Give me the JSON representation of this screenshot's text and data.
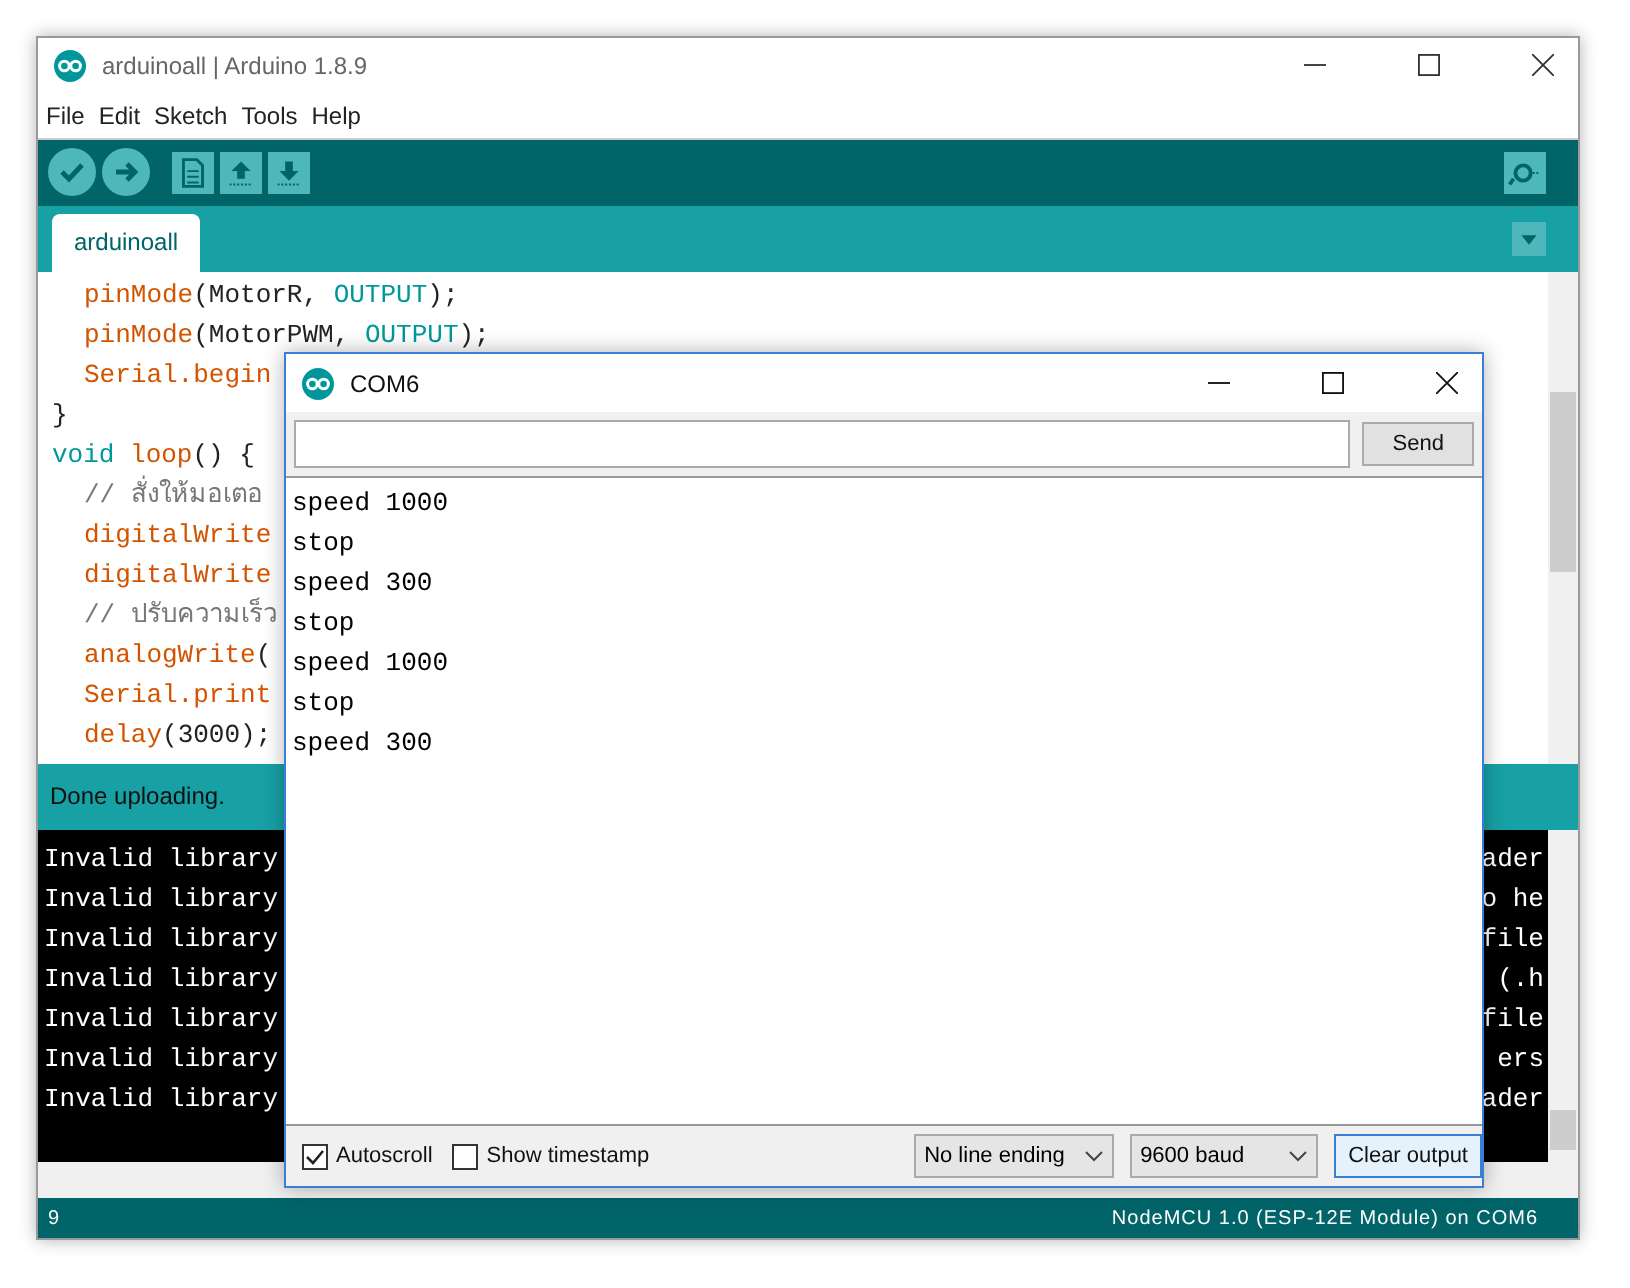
{
  "window": {
    "title": "arduinoall | Arduino 1.8.9"
  },
  "menu": [
    "File",
    "Edit",
    "Sketch",
    "Tools",
    "Help"
  ],
  "tabs": [
    {
      "label": "arduinoall",
      "selected": true
    }
  ],
  "editor": {
    "lines": [
      {
        "kind": "indented",
        "segments": [
          {
            "kind": "func",
            "text": "pinMode"
          },
          {
            "kind": "plain",
            "text": "(MotorR, "
          },
          {
            "kind": "const",
            "text": "OUTPUT"
          },
          {
            "kind": "plain",
            "text": ");"
          }
        ]
      },
      {
        "kind": "indented",
        "segments": [
          {
            "kind": "func",
            "text": "pinMode"
          },
          {
            "kind": "plain",
            "text": "(MotorPWM, "
          },
          {
            "kind": "const",
            "text": "OUTPUT"
          },
          {
            "kind": "plain",
            "text": ");"
          }
        ]
      },
      {
        "kind": "indented",
        "segments": [
          {
            "kind": "func",
            "text": "Serial.begin"
          }
        ]
      },
      {
        "kind": "top",
        "segments": [
          {
            "kind": "plain",
            "text": "}"
          }
        ]
      },
      {
        "kind": "top",
        "segments": [
          {
            "kind": "keyword",
            "text": "void"
          },
          {
            "kind": "func",
            "text": " loop"
          },
          {
            "kind": "plain",
            "text": "() {"
          }
        ]
      },
      {
        "kind": "indented",
        "segments": [
          {
            "kind": "comment",
            "text": "// สั่งให้มอเตอ"
          }
        ]
      },
      {
        "kind": "indented",
        "segments": [
          {
            "kind": "func",
            "text": "digitalWrite"
          }
        ]
      },
      {
        "kind": "indented",
        "segments": [
          {
            "kind": "func",
            "text": "digitalWrite"
          }
        ]
      },
      {
        "kind": "indented",
        "segments": [
          {
            "kind": "comment",
            "text": "// ปรับความเร็ว"
          }
        ]
      },
      {
        "kind": "indented",
        "segments": [
          {
            "kind": "func",
            "text": "analogWrite"
          },
          {
            "kind": "plain",
            "text": "("
          }
        ]
      },
      {
        "kind": "indented",
        "segments": [
          {
            "kind": "func",
            "text": "Serial.print"
          }
        ]
      },
      {
        "kind": "indented",
        "segments": [
          {
            "kind": "func",
            "text": "delay"
          },
          {
            "kind": "plain",
            "text": "(3000);"
          }
        ]
      }
    ]
  },
  "message": "Done uploading.",
  "console": [
    {
      "left": "Invalid library",
      "right": "ader"
    },
    {
      "left": "Invalid library",
      "right": "o he"
    },
    {
      "left": "Invalid library",
      "right": "file"
    },
    {
      "left": "Invalid library",
      "right": " (.h"
    },
    {
      "left": "Invalid library",
      "right": "file"
    },
    {
      "left": "Invalid library",
      "right": "ers"
    },
    {
      "left": "Invalid library",
      "right": "ader"
    }
  ],
  "status_bar": {
    "line": "9",
    "board": "NodeMCU 1.0 (ESP-12E Module) on COM6"
  },
  "serial_monitor": {
    "title": "COM6",
    "send": "Send",
    "output": [
      "speed 1000",
      "stop",
      "speed 300",
      "stop",
      "speed 1000",
      "stop",
      "speed 300"
    ],
    "autoscroll": {
      "label": "Autoscroll",
      "checked": true
    },
    "timestamp": {
      "label": "Show timestamp",
      "checked": false
    },
    "line_ending": "No line ending",
    "baud": "9600 baud",
    "clear": "Clear output"
  }
}
